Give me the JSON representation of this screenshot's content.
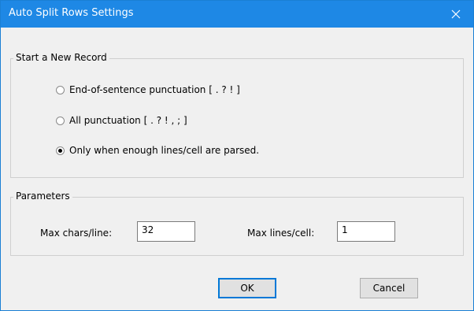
{
  "window": {
    "title": "Auto Split Rows Settings"
  },
  "record_group": {
    "legend": "Start a New Record",
    "options": [
      {
        "label": "End-of-sentence punctuation [ . ? ! ]",
        "selected": false
      },
      {
        "label": "All punctuation [ . ? ! , ; ]",
        "selected": false
      },
      {
        "label": "Only when enough lines/cell are parsed.",
        "selected": true
      }
    ]
  },
  "parameters_group": {
    "legend": "Parameters",
    "max_chars_label": "Max chars/line:",
    "max_chars_value": "32",
    "max_lines_label": "Max lines/cell:",
    "max_lines_value": "1"
  },
  "buttons": {
    "ok": "OK",
    "cancel": "Cancel"
  },
  "icons": {
    "close": "close-icon"
  },
  "colors": {
    "titlebar": "#1e88e5",
    "default_button_border": "#0078d7"
  }
}
